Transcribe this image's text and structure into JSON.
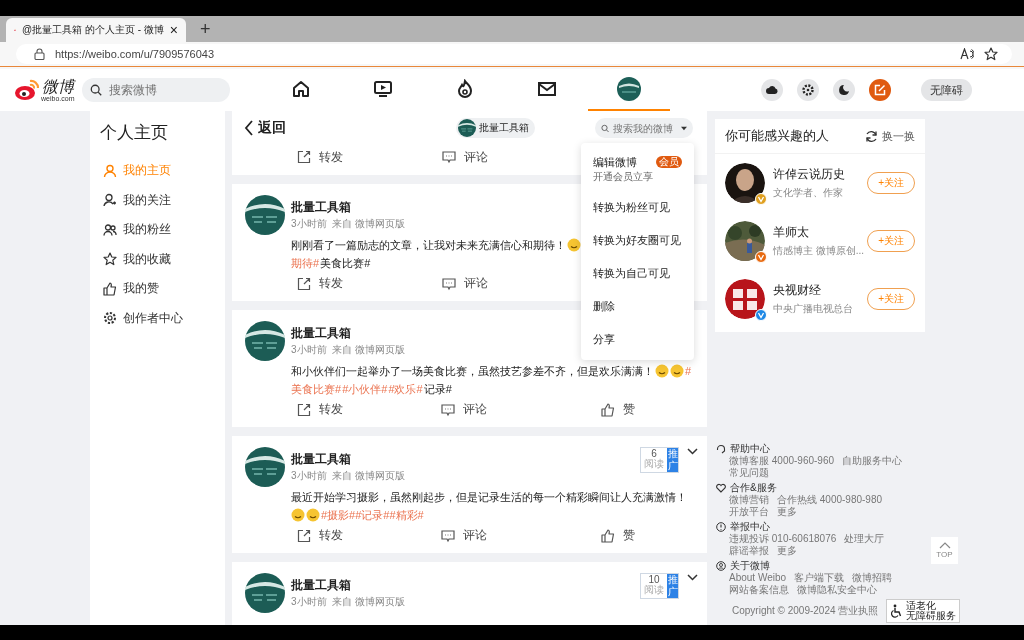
{
  "browser": {
    "tab": {
      "title": "@批量工具箱 的个人主页 - 微博",
      "close": "×"
    },
    "new_tab": "+",
    "url": "https://weibo.com/u/7909576043"
  },
  "header": {
    "logo": {
      "name": "微博",
      "domain": "weibo.com"
    },
    "search": {
      "placeholder": "搜索微博"
    },
    "nav": [
      {
        "kind": "home",
        "selected": false
      },
      {
        "kind": "video",
        "selected": false
      },
      {
        "kind": "hot",
        "selected": false
      },
      {
        "kind": "mail",
        "selected": false
      },
      {
        "kind": "avatar",
        "selected": true
      }
    ],
    "tools": [
      {
        "kind": "cloud",
        "highlight": false
      },
      {
        "kind": "settings",
        "highlight": false
      },
      {
        "kind": "moon",
        "highlight": false
      },
      {
        "kind": "compose",
        "highlight": true
      }
    ],
    "accessibility": "无障碍"
  },
  "sidebar": {
    "title": "个人主页",
    "items": [
      {
        "kind": "home",
        "label": "我的主页",
        "selected": true
      },
      {
        "kind": "follow",
        "label": "我的关注",
        "selected": false
      },
      {
        "kind": "fans",
        "label": "我的粉丝",
        "selected": false
      },
      {
        "kind": "star",
        "label": "我的收藏",
        "selected": false
      },
      {
        "kind": "like",
        "label": "我的赞",
        "selected": false
      },
      {
        "kind": "gear",
        "label": "创作者中心",
        "selected": false
      }
    ]
  },
  "feed": {
    "back": "返回",
    "user_chip": "批量工具箱",
    "search": {
      "placeholder": "搜索我的微博"
    },
    "partial_actions": [
      "转发",
      "评论"
    ],
    "posts": [
      {
        "name": "批量工具箱",
        "meta": "3小时前  来自 微博网页版",
        "lines": [
          [
            {
              "kind": "text",
              "text": "刚刚看了一篇励志的文章，让我对未来充满信心和期待！"
            },
            {
              "kind": "emoji"
            }
          ],
          [
            {
              "kind": "tag",
              "text": "期待#"
            },
            {
              "kind": "text",
              "text": "美食比赛#"
            }
          ]
        ],
        "actions": [
          "转发",
          "评论"
        ]
      },
      {
        "name": "批量工具箱",
        "meta": "3小时前  来自 微博网页版",
        "lines": [
          [
            {
              "kind": "text",
              "text": "和小伙伴们一起举办了一场美食比赛，虽然技艺参差不齐，但是欢乐满满！"
            },
            {
              "kind": "emoji"
            },
            {
              "kind": "emoji"
            },
            {
              "kind": "tag",
              "text": "#"
            }
          ],
          [
            {
              "kind": "tag",
              "text": "美食比赛#"
            },
            {
              "kind": "tag",
              "text": "#小伙伴#"
            },
            {
              "kind": "tag",
              "text": "#欢乐#"
            },
            {
              "kind": "text",
              "text": "记录#"
            }
          ]
        ],
        "actions": [
          "转发",
          "评论",
          "赞"
        ]
      },
      {
        "name": "批量工具箱",
        "meta": "3小时前  来自 微博网页版",
        "reads": {
          "count": "6",
          "label": "阅读",
          "promo": "推广"
        },
        "lines": [
          [
            {
              "kind": "text",
              "text": "最近开始学习摄影，虽然刚起步，但是记录生活的每一个精彩瞬间让人充满激情！"
            }
          ],
          [
            {
              "kind": "emoji"
            },
            {
              "kind": "emoji"
            },
            {
              "kind": "tag",
              "text": "#摄影##记录##精彩#"
            }
          ]
        ],
        "actions": [
          "转发",
          "评论",
          "赞"
        ]
      },
      {
        "name": "批量工具箱",
        "meta": "3小时前  来自 微博网页版",
        "reads": {
          "count": "10",
          "label": "阅读",
          "promo": "推广"
        }
      }
    ],
    "menu": {
      "items": [
        {
          "label": "编辑微博",
          "sub": "开通会员立享",
          "badge": "会员"
        },
        {
          "label": "转换为粉丝可见"
        },
        {
          "label": "转换为好友圈可见"
        },
        {
          "label": "转换为自己可见"
        },
        {
          "label": "删除"
        },
        {
          "label": "分享"
        }
      ]
    }
  },
  "suggestions": {
    "title": "你可能感兴趣的人",
    "refresh": "换一换",
    "people": [
      {
        "name": "许倬云说历史",
        "desc": "文化学者、作家",
        "color": "#e0a020",
        "kind": "elder",
        "follow": "+关注"
      },
      {
        "name": "羊师太",
        "desc": "情感博主 微博原创...",
        "color": "#e86a10",
        "kind": "outdoor",
        "follow": "+关注"
      },
      {
        "name": "央视财经",
        "desc": "中央广播电视总台",
        "color": "#1e88e5",
        "kind": "red",
        "follow": "+关注"
      }
    ]
  },
  "footer": {
    "sections": [
      {
        "kind": "help",
        "title": "帮助中心",
        "links": [
          "微博客服 4000-960-960",
          "自助服务中心",
          "常见问题"
        ]
      },
      {
        "kind": "heart",
        "title": "合作&服务",
        "links": [
          "微博营销",
          "合作热线 4000-980-980",
          "开放平台",
          "更多"
        ]
      },
      {
        "kind": "alert",
        "title": "举报中心",
        "links": [
          "违规投诉 010-60618076",
          "处理大厅",
          "辟谣举报",
          "更多"
        ]
      },
      {
        "kind": "about",
        "title": "关于微博",
        "links": [
          "About Weibo",
          "客户端下载",
          "微博招聘",
          "网站备案信息",
          "微博隐私安全中心"
        ]
      }
    ],
    "copyright": "Copyright © 2009-2024 营业执照",
    "badge": [
      "适老化",
      "无障碍服务"
    ]
  },
  "top_button": "TOP"
}
